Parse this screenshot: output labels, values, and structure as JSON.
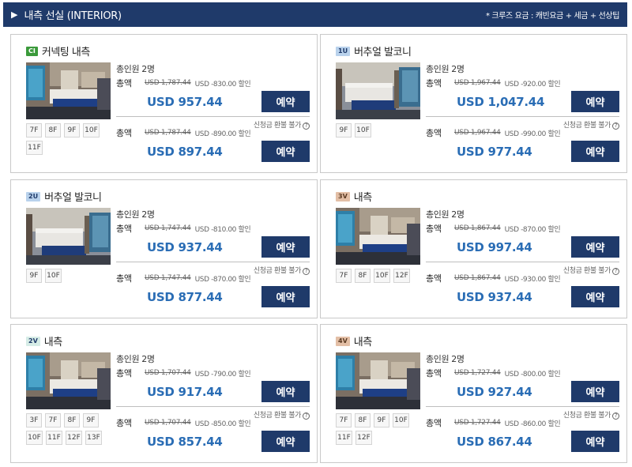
{
  "header": {
    "title": "내측 선실 (INTERIOR)",
    "note": "* 크루즈 요금 : 캐빈요금 + 세금 + 선상팁"
  },
  "labels": {
    "total": "총액",
    "book": "예약",
    "refund": "신청금 환불 불가",
    "currency": "USD"
  },
  "cards": [
    {
      "code": "CI",
      "code_style": "green",
      "name": "커넥팅 내측",
      "photo": "interior-room-ocean-screen",
      "decks": [
        "7F",
        "8F",
        "9F",
        "10F",
        "11F"
      ],
      "pax": "총인원 2명",
      "offers": [
        {
          "original": "USD 1,787.44",
          "discount": "USD -830.00 할인",
          "price": "USD 957.44"
        },
        {
          "original": "USD 1,787.44",
          "discount": "USD -890.00 할인",
          "price": "USD 897.44"
        }
      ]
    },
    {
      "code": "1U",
      "code_style": "blue",
      "name": "버추얼 발코니",
      "photo": "virtual-balcony-room",
      "decks": [
        "9F",
        "10F"
      ],
      "pax": "총인원 2명",
      "offers": [
        {
          "original": "USD 1,967.44",
          "discount": "USD -920.00 할인",
          "price": "USD 1,047.44"
        },
        {
          "original": "USD 1,967.44",
          "discount": "USD -990.00 할인",
          "price": "USD 977.44"
        }
      ]
    },
    {
      "code": "2U",
      "code_style": "blue",
      "name": "버추얼 발코니",
      "photo": "virtual-balcony-room",
      "decks": [
        "9F",
        "10F"
      ],
      "pax": "총인원 2명",
      "offers": [
        {
          "original": "USD 1,747.44",
          "discount": "USD -810.00 할인",
          "price": "USD 937.44"
        },
        {
          "original": "USD 1,747.44",
          "discount": "USD -870.00 할인",
          "price": "USD 877.44"
        }
      ]
    },
    {
      "code": "3V",
      "code_style": "tan",
      "name": "내측",
      "photo": "interior-room-ocean-screen",
      "decks": [
        "7F",
        "8F",
        "10F",
        "12F"
      ],
      "pax": "총인원 2명",
      "offers": [
        {
          "original": "USD 1,867.44",
          "discount": "USD -870.00 할인",
          "price": "USD 997.44"
        },
        {
          "original": "USD 1,867.44",
          "discount": "USD -930.00 할인",
          "price": "USD 937.44"
        }
      ]
    },
    {
      "code": "2V",
      "code_style": "pale",
      "name": "내측",
      "photo": "interior-room-ocean-screen",
      "decks": [
        "3F",
        "7F",
        "8F",
        "9F",
        "10F",
        "11F",
        "12F",
        "13F"
      ],
      "pax": "총인원 2명",
      "offers": [
        {
          "original": "USD 1,707.44",
          "discount": "USD -790.00 할인",
          "price": "USD 917.44"
        },
        {
          "original": "USD 1,707.44",
          "discount": "USD -850.00 할인",
          "price": "USD 857.44"
        }
      ]
    },
    {
      "code": "4V",
      "code_style": "tan",
      "name": "내측",
      "photo": "interior-room-ocean-screen",
      "decks": [
        "7F",
        "8F",
        "9F",
        "10F",
        "11F",
        "12F"
      ],
      "pax": "총인원 2명",
      "offers": [
        {
          "original": "USD 1,727.44",
          "discount": "USD -800.00 할인",
          "price": "USD 927.44"
        },
        {
          "original": "USD 1,727.44",
          "discount": "USD -860.00 할인",
          "price": "USD 867.44"
        }
      ]
    }
  ]
}
